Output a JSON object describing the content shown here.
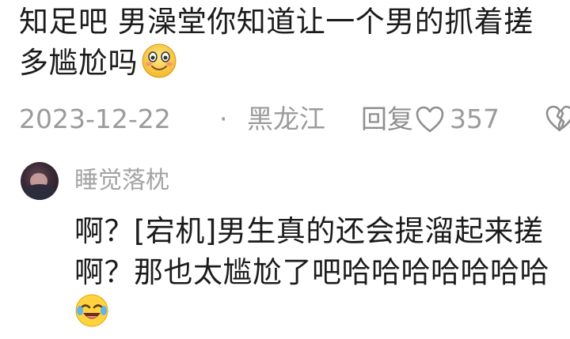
{
  "comment": {
    "text": "知足吧 男澡堂你知道让一个男的抓着搓多尴尬吗",
    "emoji": "blush-smile-emoji"
  },
  "meta": {
    "date": "2023-12-22",
    "separator": "·",
    "location": "黑龙江",
    "reply_label": "回复",
    "like_count": "357",
    "like_icon": "heart-outline-icon",
    "dislike_icon": "broken-heart-icon"
  },
  "reply": {
    "avatar": "avatar",
    "username": "睡觉落枕",
    "text": "啊？[宕机]男生真的还会提溜起来搓啊？那也太尴尬了吧哈哈哈哈哈哈哈",
    "emoji": "laugh-cry-emoji"
  },
  "colors": {
    "text": "#1b1b1b",
    "meta": "#9b9b9b",
    "username": "#a3a3a3",
    "background": "#ffffff"
  }
}
